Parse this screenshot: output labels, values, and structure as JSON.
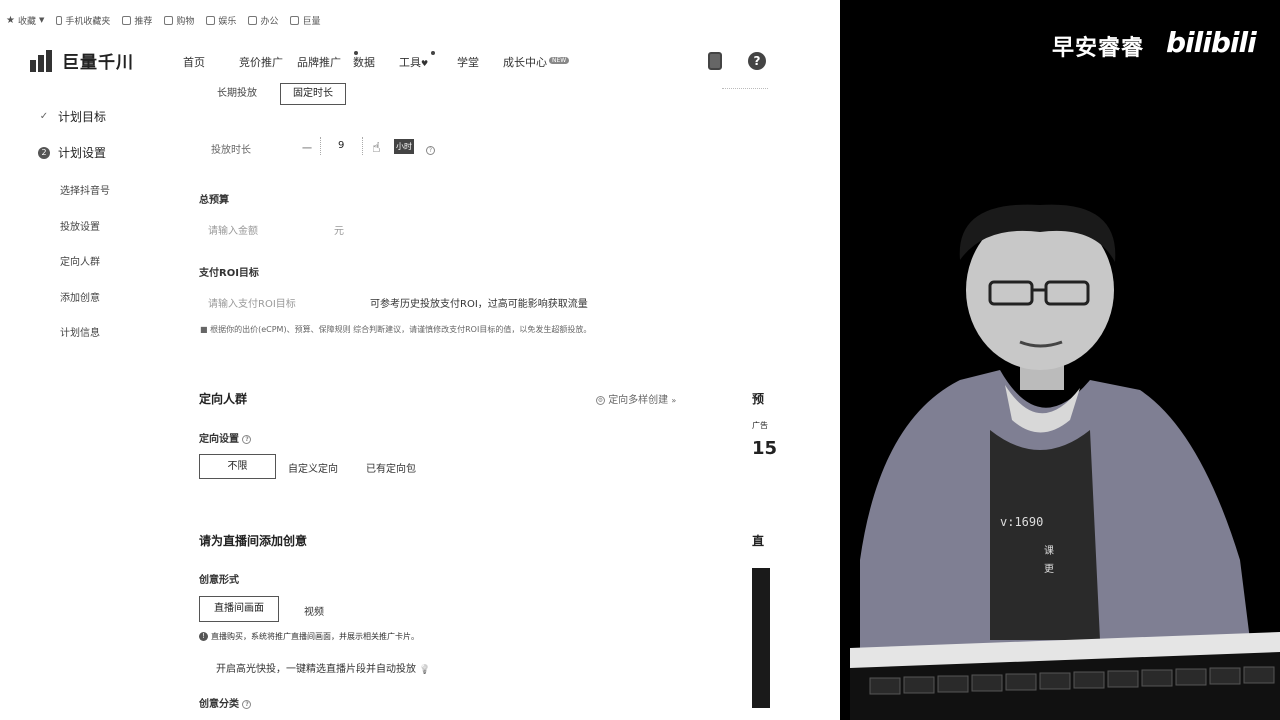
{
  "bookmarks": [
    {
      "label": "收藏",
      "icon": "star-icon"
    },
    {
      "label": "手机收藏夹",
      "icon": "phone-icon"
    },
    {
      "label": "推荐",
      "icon": "folder-icon"
    },
    {
      "label": "购物",
      "icon": "folder-icon"
    },
    {
      "label": "娱乐",
      "icon": "folder-icon"
    },
    {
      "label": "办公",
      "icon": "folder-icon"
    },
    {
      "label": "巨量",
      "icon": "folder-icon"
    }
  ],
  "header": {
    "logo_text": "巨量千川",
    "nav": [
      {
        "label": "首页",
        "dot": false,
        "badge": ""
      },
      {
        "label": "竞价推广",
        "dot": false,
        "badge": ""
      },
      {
        "label": "品牌推广",
        "dot": true,
        "badge": ""
      },
      {
        "label": "数据",
        "dot": false,
        "badge": ""
      },
      {
        "label": "工具",
        "dot": true,
        "badge": ""
      },
      {
        "label": "学堂",
        "dot": false,
        "badge": ""
      },
      {
        "label": "成长中心",
        "dot": false,
        "badge": "NEW"
      }
    ],
    "help_glyph": "?"
  },
  "sidebar": {
    "steps": [
      {
        "label": "计划目标",
        "state": "done"
      },
      {
        "label": "计划设置",
        "state": "current",
        "num": "2"
      }
    ],
    "substeps": [
      "选择抖音号",
      "投放设置",
      "定向人群",
      "添加创意",
      "计划信息"
    ]
  },
  "form": {
    "delivery_mode": {
      "options": [
        "长期投放",
        "固定时长"
      ],
      "selected": "固定时长"
    },
    "duration": {
      "label": "投放时长",
      "prefix": "一",
      "value": "9",
      "unit": "小时"
    },
    "budget": {
      "label": "总预算",
      "placeholder": "请输入金额",
      "suffix": "元"
    },
    "roi": {
      "label": "支付ROI目标",
      "placeholder": "请输入支付ROI目标",
      "hint": "可参考历史投放支付ROI，过高可能影响获取流量",
      "note": "根据你的出价(eCPM)、预算、保障规则 综合判断建议，请谨慎修改支付ROI目标的值，以免发生超额投放。"
    },
    "targeting": {
      "title": "定向人群",
      "multi_label": "定向多样创建",
      "setting_label": "定向设置",
      "options": [
        "不限",
        "自定义定向",
        "已有定向包"
      ],
      "selected": "不限"
    },
    "creative": {
      "title": "请为直播间添加创意",
      "form_label": "创意形式",
      "options": [
        "直播间画面",
        "视频"
      ],
      "selected": "直播间画面",
      "info": "直播购买，系统将推广直播间画面，并展示相关推广卡片。",
      "quick_delivery": "开启高光快投，一键精选直播片段并自动投放",
      "category_label": "创意分类"
    },
    "right_panel": {
      "title": "预",
      "sub": "广告",
      "number": "15",
      "title2": "直"
    }
  },
  "video": {
    "watermark": "早安睿睿",
    "brand": "bilibili",
    "contact": "v:1690",
    "sub1": "课",
    "sub2": "更"
  }
}
